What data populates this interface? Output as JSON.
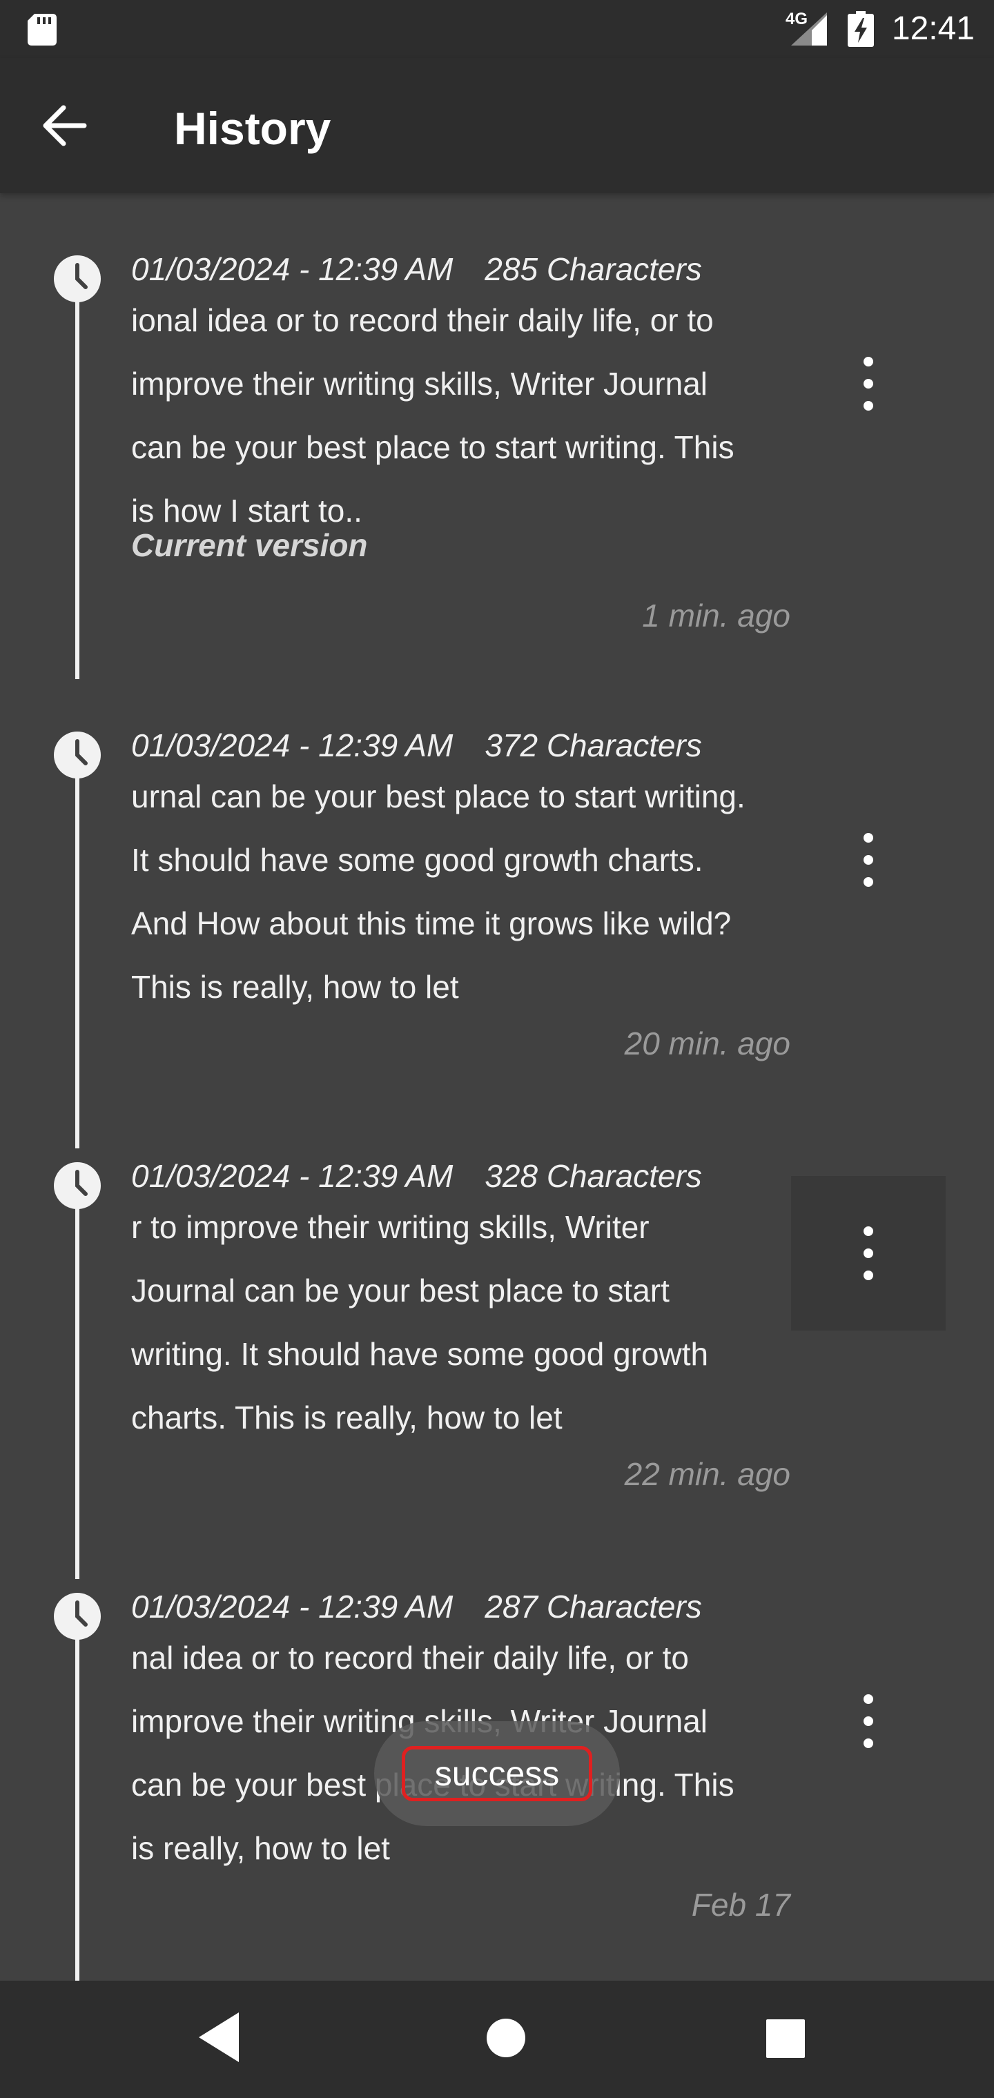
{
  "status_bar": {
    "network": "4G",
    "time": "12:41",
    "icons": [
      "sd-card-icon",
      "signal-icon",
      "battery-charging-icon"
    ]
  },
  "app_bar": {
    "title": "History",
    "back_icon": "arrow-back-icon"
  },
  "entries": [
    {
      "date": "01/03/2024 - 12:39 AM",
      "chars": "285 Characters",
      "text": "ional idea or to record their daily life, or to\nimprove their writing skills, Writer Journal\ncan be your best place to start writing. This\nis how I start to..",
      "current": "Current version",
      "time": "1 min. ago"
    },
    {
      "date": "01/03/2024 - 12:39 AM",
      "chars": "372 Characters",
      "text": "urnal can be your best place to start writing.\nIt should have some good growth charts.\nAnd How about this time it grows like wild?\nThis is really, how to let",
      "current": "",
      "time": "20 min. ago"
    },
    {
      "date": "01/03/2024 - 12:39 AM",
      "chars": "328 Characters",
      "text": "r to improve their writing skills, Writer\nJournal can be your best place to start\nwriting. It should have some good growth\ncharts. This is really, how to let",
      "current": "",
      "time": "22 min. ago"
    },
    {
      "date": "01/03/2024 - 12:39 AM",
      "chars": "287 Characters",
      "text": "nal idea or to record their daily life, or to\nimprove their writing skills, Writer Journal\ncan be your best place to start writing. This\nis really, how to let",
      "current": "",
      "time": "Feb 17"
    }
  ],
  "toast": {
    "label": "success"
  },
  "nav_bar": {
    "icons": [
      "nav-back-icon",
      "nav-home-icon",
      "nav-recents-icon"
    ]
  },
  "colors": {
    "background": "#414141",
    "bars": "#2d2d2d",
    "text": "#f0f0f0",
    "muted": "#9a9a9a",
    "toast_border": "#e02020"
  }
}
